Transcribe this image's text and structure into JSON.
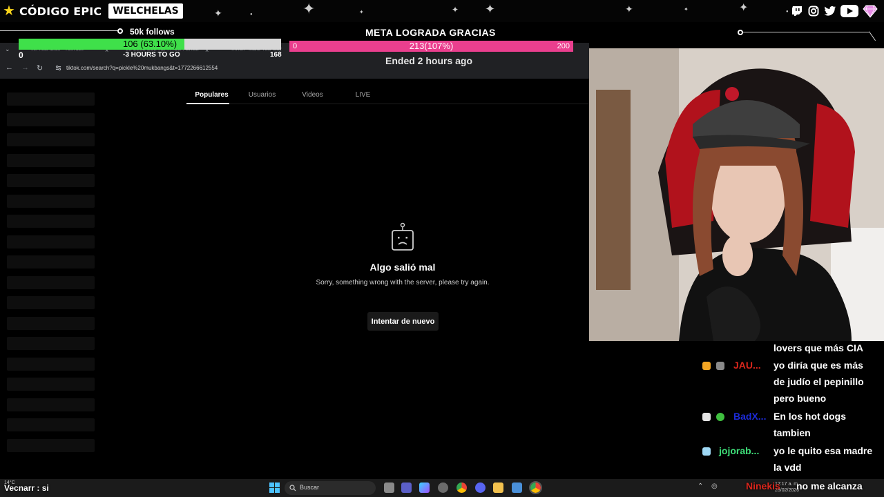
{
  "overlay": {
    "brand_name": "CÓDIGO EPIC",
    "brand_sponsor": "WELCHELAS",
    "follow_goal": {
      "label": "50k follows",
      "bar_text": "106 (63.10%)",
      "min": "0",
      "progress_percent": 63.1,
      "countdown": "-3 HOURS TO GO",
      "side_value": "168"
    },
    "meta_goal": {
      "title": "META LOGRADA GRACIAS",
      "bar_text": "213(107%)",
      "min": "0",
      "max": "200",
      "progress_percent": 100,
      "ended": "Ended 2 hours ago"
    },
    "socials": [
      "twitch-icon",
      "instagram-icon",
      "twitter-icon",
      "youtube-icon",
      "diamond-icon"
    ]
  },
  "browser": {
    "tabs": [
      {
        "label": "Ver más tarde - YouTube"
      },
      {
        "label": "EL CLUB DEL TOPPA DE PEREZ"
      },
      {
        "label": "TikTok - Make Your Day"
      }
    ],
    "url": "tiktok.com/search?q=pickle%20mukbangs&t=1772266612554"
  },
  "tiktok": {
    "tabs": [
      "Populares",
      "Usuarios",
      "Videos",
      "LIVE"
    ],
    "error_title": "Algo salió mal",
    "error_subtitle": "Sorry, something wrong with the server, please try again.",
    "retry_label": "Intentar de nuevo"
  },
  "chat": {
    "messages": [
      {
        "user": "",
        "text": "lovers que más CIA",
        "color": ""
      },
      {
        "user": "JAU...",
        "text": "yo diría que es más",
        "color": "#d9261c"
      },
      {
        "user": "",
        "text": "de judío el pepinillo",
        "color": ""
      },
      {
        "user": "",
        "text": "pero bueno",
        "color": ""
      },
      {
        "user": "BadX...",
        "text": "En los hot dogs",
        "color": "#1c2bd9"
      },
      {
        "user": "",
        "text": "tambien",
        "color": ""
      },
      {
        "user": "jojorab...",
        "text": "yo le quito esa madre",
        "color": "#3fe07a"
      },
      {
        "user": "",
        "text": "la vdd",
        "color": ""
      }
    ],
    "bottom_left": "Vecnarr : si",
    "bottom_right_user": "Ninekis",
    "bottom_right_text": "no me alcanza"
  },
  "taskbar": {
    "weather": "14°C",
    "search_placeholder": "Buscar",
    "time": "12:17 a. m.",
    "date": "28/02/2026"
  }
}
